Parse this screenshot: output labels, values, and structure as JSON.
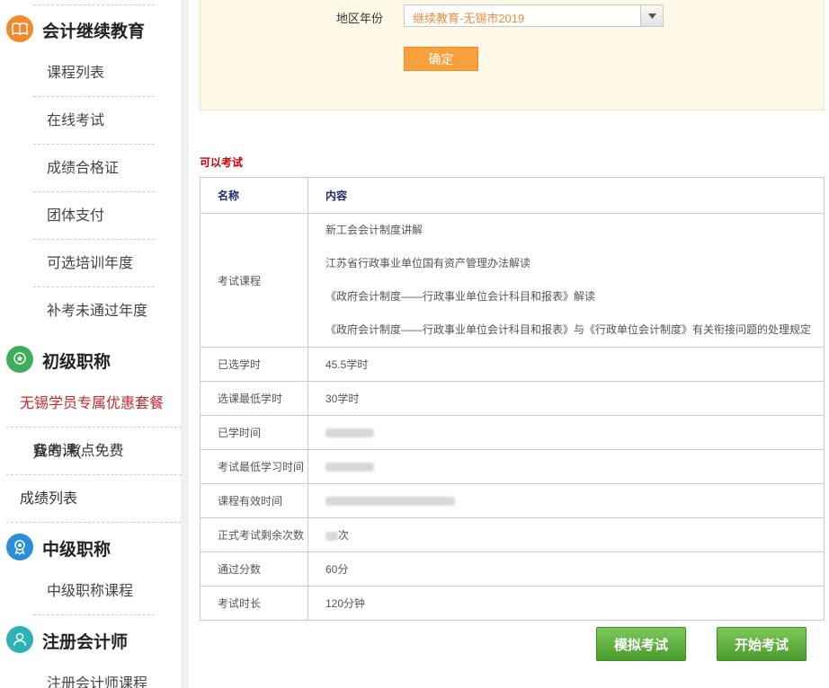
{
  "sidebar": {
    "categories": [
      {
        "title": "会计继续教育",
        "icon": "book-icon",
        "items": [
          "课程列表",
          "在线考试",
          "成绩合格证",
          "团体支付",
          "可选培训年度",
          "补考未通过年度"
        ]
      },
      {
        "title": "初级职称",
        "icon": "award-icon",
        "items": []
      },
      {
        "title": "中级职称",
        "icon": "medal-icon",
        "items": [
          "中级职称课程"
        ]
      },
      {
        "title": "注册会计师",
        "icon": "user-icon",
        "items": [
          "注册会计师课程"
        ]
      }
    ],
    "flat_items": {
      "promo": "无锡学员专属优惠套餐",
      "my_courses_prefix": "我的课(",
      "my_courses_red": "备考,考点免费",
      "my_courses_suffix": ")",
      "scores": "成绩列表"
    }
  },
  "filter": {
    "label": "地区年份",
    "selected": "继续教育-无锡市2019",
    "confirm": "确定"
  },
  "section_title": "可以考试",
  "table": {
    "headers": [
      "名称",
      "内容"
    ],
    "courses_label": "考试课程",
    "courses": [
      "新工会会计制度讲解",
      "江苏省行政事业单位国有资产管理办法解读",
      "《政府会计制度——行政事业单位会计科目和报表》解读",
      "《政府会计制度——行政事业单位会计科目和报表》与《行政单位会计制度》有关衔接问题的处理规定"
    ],
    "rows": [
      {
        "label": "已选学时",
        "value": "45.5学时"
      },
      {
        "label": "选课最低学时",
        "value": "30学时"
      },
      {
        "label": "已学时间",
        "value": ""
      },
      {
        "label": "考试最低学习时间",
        "value": ""
      },
      {
        "label": "课程有效时间",
        "value": ""
      },
      {
        "label": "正式考试剩余次数",
        "value": "次"
      },
      {
        "label": "通过分数",
        "value": "60分"
      },
      {
        "label": "考试时长",
        "value": "120分钟"
      }
    ]
  },
  "buttons": {
    "mock_exam": "模拟考试",
    "start_exam": "开始考试"
  },
  "colors": {
    "accent_orange": "#f7a03c",
    "alert_red": "#cc0000",
    "green_button": "#4a9c2c",
    "panel_bg": "#fef9e7"
  }
}
